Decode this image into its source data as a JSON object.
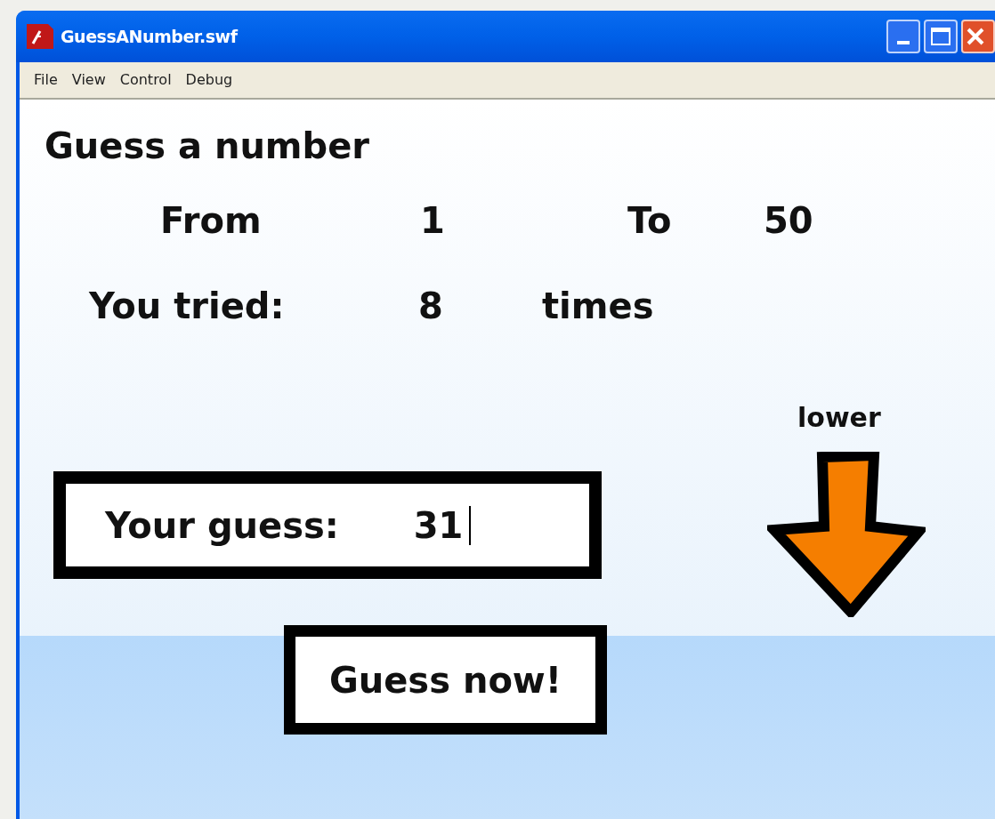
{
  "window": {
    "title": "GuessANumber.swf"
  },
  "menu": [
    "File",
    "View",
    "Control",
    "Debug"
  ],
  "game": {
    "heading": "Guess a number",
    "range": {
      "from_label": "From",
      "from_value": "1",
      "to_label": "To",
      "to_value": "50"
    },
    "tries": {
      "label": "You tried:",
      "count": "8",
      "unit": "times"
    },
    "hint": {
      "text": "lower"
    },
    "guess": {
      "label": "Your guess:",
      "value": "31"
    },
    "button": "Guess now!"
  }
}
